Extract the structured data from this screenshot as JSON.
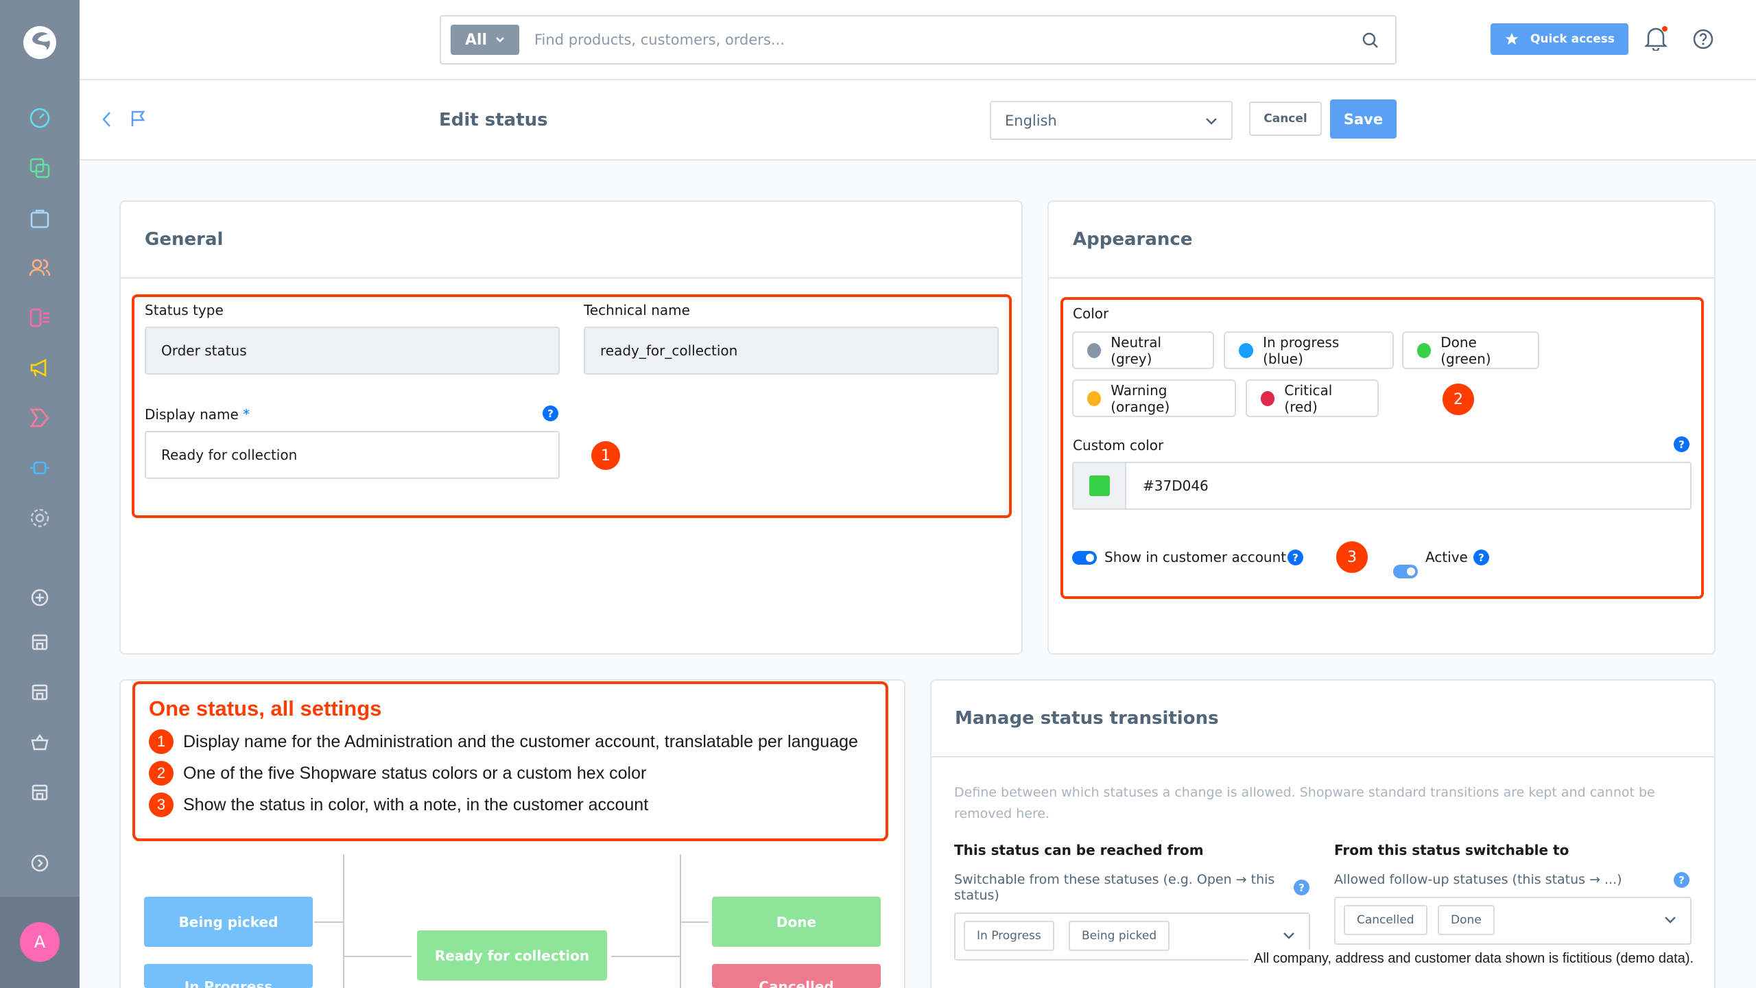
{
  "header": {
    "search_scope": "All",
    "search_placeholder": "Find products, customers, orders...",
    "quick_access_label": "Quick access"
  },
  "smartbar": {
    "title": "Edit status",
    "language": "English",
    "cancel_label": "Cancel",
    "save_label": "Save"
  },
  "sidebar": {
    "avatar_initial": "A"
  },
  "general": {
    "title": "General",
    "status_type_label": "Status type",
    "status_type_value": "Order status",
    "technical_name_label": "Technical name",
    "technical_name_value": "ready_for_collection",
    "display_name_label": "Display name",
    "required_mark": "*",
    "display_name_value": "Ready for collection",
    "callout": "1"
  },
  "appearance": {
    "title": "Appearance",
    "color_label": "Color",
    "colors": [
      {
        "label": "Neutral (grey)",
        "color": "#8796a6"
      },
      {
        "label": "In progress (blue)",
        "color": "#189eff"
      },
      {
        "label": "Done (green)",
        "color": "#37d046"
      },
      {
        "label": "Warning (orange)",
        "color": "#ffb21d"
      },
      {
        "label": "Critical (red)",
        "color": "#de294c"
      }
    ],
    "callout_colors": "2",
    "custom_color_label": "Custom color",
    "custom_color_value": "#37D046",
    "custom_color_swatch": "#37d046",
    "show_in_account_label": "Show in customer account",
    "active_label": "Active",
    "callout_toggles": "3"
  },
  "annotation": {
    "title": "One status, all settings",
    "items": [
      {
        "num": "1",
        "text": "Display name for the Administration and the customer account, translatable per language"
      },
      {
        "num": "2",
        "text": "One of the five Shopware status colors or a custom hex color"
      },
      {
        "num": "3",
        "text": "Show the status in color, with a note, in the customer account"
      }
    ]
  },
  "flow": {
    "being_picked": "Being picked",
    "in_progress_partial": "In Progress",
    "ready_for_collection": "Ready for collection",
    "done": "Done",
    "cancelled_partial": "Cancelled"
  },
  "transitions": {
    "title": "Manage status transitions",
    "description": "Define between which statuses a change is allowed. Shopware standard transitions are kept and cannot be removed here.",
    "from_title": "This status can be reached from",
    "from_help": "Switchable from these statuses (e.g. Open → this status)",
    "from_tags": [
      "In Progress",
      "Being picked"
    ],
    "to_title": "From this status switchable to",
    "to_help": "Allowed follow-up statuses (this status → ...)",
    "to_tags": [
      "Cancelled",
      "Done"
    ]
  },
  "footer_note": "All company, address and customer data shown is fictitious (demo data)."
}
